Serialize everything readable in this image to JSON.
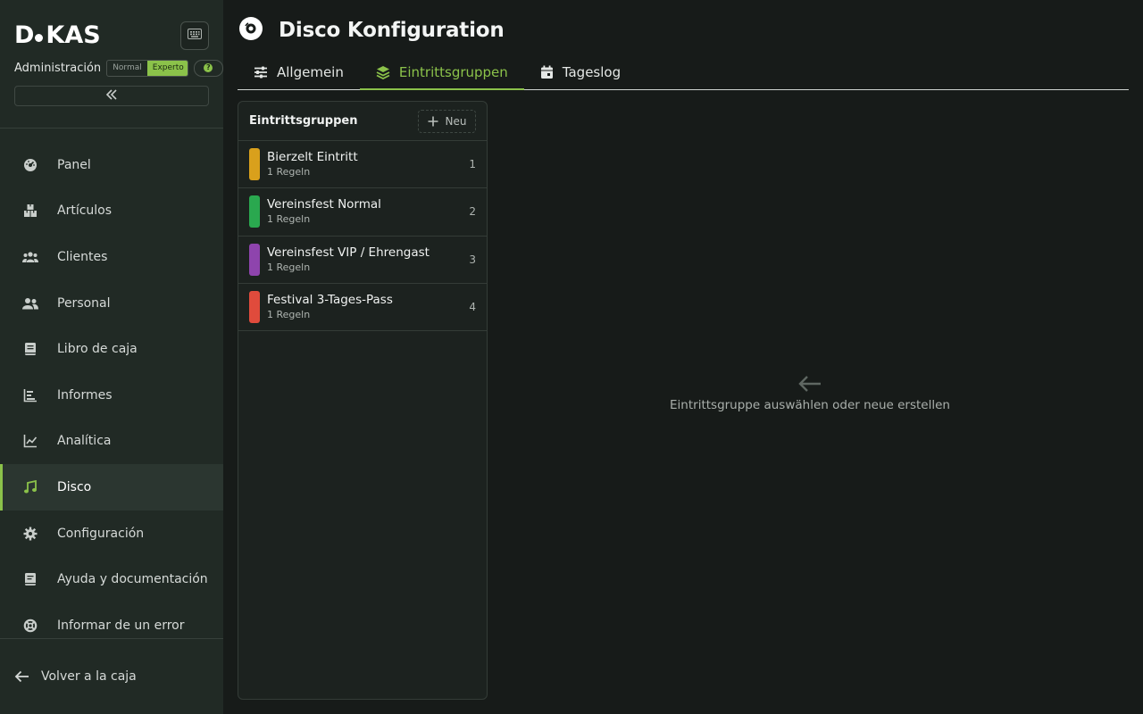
{
  "app": {
    "logo_text_left": "D",
    "logo_text_right": "KAS",
    "admin_label": "Administración",
    "mode_normal": "Normal",
    "mode_expert": "Experto",
    "help_badge": "?"
  },
  "sidebar": {
    "items": [
      {
        "label": "Panel",
        "icon": "dashboard-icon",
        "active": false
      },
      {
        "label": "Artículos",
        "icon": "boxes-icon",
        "active": false
      },
      {
        "label": "Clientes",
        "icon": "users-group-icon",
        "active": false
      },
      {
        "label": "Personal",
        "icon": "staff-icon",
        "active": false
      },
      {
        "label": "Libro de caja",
        "icon": "book-icon",
        "active": false
      },
      {
        "label": "Informes",
        "icon": "bar-chart-icon",
        "active": false
      },
      {
        "label": "Analítica",
        "icon": "line-chart-icon",
        "active": false
      },
      {
        "label": "Disco",
        "icon": "music-note-icon",
        "active": true
      },
      {
        "label": "Configuración",
        "icon": "gear-icon",
        "active": false
      },
      {
        "label": "Ayuda y documentación",
        "icon": "help-book-icon",
        "active": false
      },
      {
        "label": "Informar de un error",
        "icon": "lifebuoy-icon",
        "active": false
      }
    ],
    "back_label": "Volver a la caja"
  },
  "page": {
    "title": "Disco Konfiguration",
    "tabs": [
      {
        "label": "Allgemein",
        "icon": "sliders-icon",
        "active": false
      },
      {
        "label": "Eintrittsgruppen",
        "icon": "layers-icon",
        "active": true
      },
      {
        "label": "Tageslog",
        "icon": "calendar-icon",
        "active": false
      }
    ]
  },
  "groups_panel": {
    "title": "Eintrittsgruppen",
    "new_label": "Neu",
    "groups": [
      {
        "name": "Bierzelt Eintritt",
        "rules": "1 Regeln",
        "num": "1",
        "color": "#d9a01c"
      },
      {
        "name": "Vereinsfest Normal",
        "rules": "1 Regeln",
        "num": "2",
        "color": "#2aa84f"
      },
      {
        "name": "Vereinsfest VIP / Ehrengast",
        "rules": "1 Regeln",
        "num": "3",
        "color": "#8e44ad"
      },
      {
        "name": "Festival 3-Tages-Pass",
        "rules": "1 Regeln",
        "num": "4",
        "color": "#e04b3c"
      }
    ]
  },
  "empty_state": {
    "text": "Eintrittsgruppe auswählen oder neue erstellen"
  },
  "colors": {
    "accent": "#8bc24a",
    "sidebar_bg": "#212a25",
    "main_bg": "#171b19"
  }
}
